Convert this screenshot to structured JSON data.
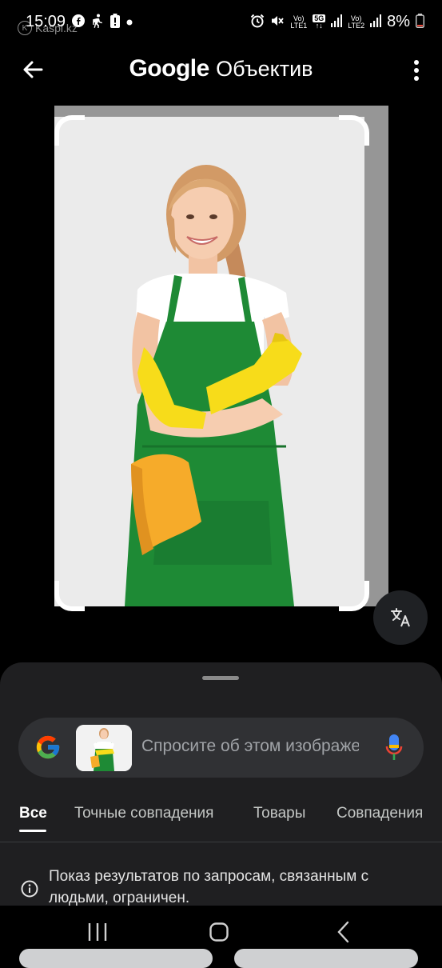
{
  "status_bar": {
    "time": "15:09",
    "battery": "8%",
    "sim1_top": "Vo)",
    "sim1_bottom": "LTE1",
    "network_5g": "5G",
    "sim2_top": "Vo)",
    "sim2_bottom": "LTE2",
    "watermark": "Kaspi.kz"
  },
  "app_bar": {
    "title_brand": "Google",
    "title_product": "Объектив"
  },
  "search": {
    "placeholder": "Спросите об этом изображении"
  },
  "tabs": [
    {
      "label": "Все",
      "active": true
    },
    {
      "label": "Точные совпадения",
      "active": false
    },
    {
      "label": "Товары",
      "active": false
    },
    {
      "label": "Совпадения",
      "active": false
    }
  ],
  "notice": {
    "text": "Показ результатов по запросам, связанным с людьми, ограничен."
  },
  "colors": {
    "background": "#000000",
    "sheet": "#1f1f21",
    "search_field": "#303134",
    "apron_green": "#1e8a35",
    "glove_yellow": "#f7dc1a",
    "cloth_orange": "#f6ab2a"
  }
}
